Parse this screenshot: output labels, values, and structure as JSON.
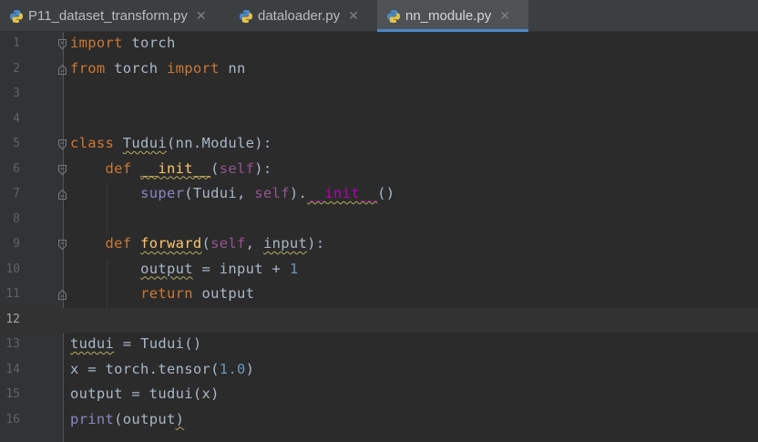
{
  "tabs": [
    {
      "label": "P11_dataset_transform.py",
      "active": false,
      "close": "✕"
    },
    {
      "label": "dataloader.py",
      "active": false,
      "close": "✕"
    },
    {
      "label": "nn_module.py",
      "active": true,
      "close": "✕"
    }
  ],
  "editor": {
    "current_line": 12,
    "lines": [
      {
        "n": "1",
        "tokens": [
          {
            "t": "import",
            "c": "kw"
          },
          {
            "t": " torch"
          }
        ]
      },
      {
        "n": "2",
        "tokens": [
          {
            "t": "from",
            "c": "kw"
          },
          {
            "t": " torch "
          },
          {
            "t": "import",
            "c": "kw"
          },
          {
            "t": " nn"
          }
        ]
      },
      {
        "n": "3",
        "tokens": []
      },
      {
        "n": "4",
        "tokens": []
      },
      {
        "n": "5",
        "tokens": [
          {
            "t": "class ",
            "c": "kw"
          },
          {
            "t": "Tudui",
            "c": "wavy"
          },
          {
            "t": "(nn.Module):"
          }
        ]
      },
      {
        "n": "6",
        "tokens": [
          {
            "t": "    "
          },
          {
            "t": "def ",
            "c": "kw"
          },
          {
            "t": "__init__",
            "c": "fn wavy"
          },
          {
            "t": "("
          },
          {
            "t": "self",
            "c": "self"
          },
          {
            "t": "):"
          }
        ]
      },
      {
        "n": "7",
        "tokens": [
          {
            "t": "        "
          },
          {
            "t": "super",
            "c": "bi"
          },
          {
            "t": "(Tudui, "
          },
          {
            "t": "self",
            "c": "self"
          },
          {
            "t": ")."
          },
          {
            "t": "__init__",
            "c": "magic wavy"
          },
          {
            "t": "()"
          }
        ]
      },
      {
        "n": "8",
        "tokens": []
      },
      {
        "n": "9",
        "tokens": [
          {
            "t": "    "
          },
          {
            "t": "def ",
            "c": "kw"
          },
          {
            "t": "forward",
            "c": "fn wavy"
          },
          {
            "t": "("
          },
          {
            "t": "self",
            "c": "self"
          },
          {
            "t": ", "
          },
          {
            "t": "input",
            "c": "wavy"
          },
          {
            "t": "):"
          }
        ]
      },
      {
        "n": "10",
        "tokens": [
          {
            "t": "        "
          },
          {
            "t": "output",
            "c": "wavy"
          },
          {
            "t": " = input + "
          },
          {
            "t": "1",
            "c": "num"
          }
        ]
      },
      {
        "n": "11",
        "tokens": [
          {
            "t": "        "
          },
          {
            "t": "return",
            "c": "kw"
          },
          {
            "t": " output"
          }
        ]
      },
      {
        "n": "12",
        "tokens": []
      },
      {
        "n": "13",
        "tokens": [
          {
            "t": "tudui",
            "c": "wavy"
          },
          {
            "t": " = Tudui()"
          }
        ]
      },
      {
        "n": "14",
        "tokens": [
          {
            "t": "x = torch.tensor("
          },
          {
            "t": "1.0",
            "c": "num"
          },
          {
            "t": ")"
          }
        ]
      },
      {
        "n": "15",
        "tokens": [
          {
            "t": "output = tudui(x)"
          }
        ]
      },
      {
        "n": "16",
        "tokens": [
          {
            "t": "print",
            "c": "bi"
          },
          {
            "t": "(output"
          },
          {
            "t": ")",
            "c": "wavy"
          }
        ]
      }
    ]
  },
  "colors": {
    "background": "#2b2b2b",
    "gutter": "#313335",
    "keyword": "#cc7832",
    "self": "#94558d",
    "function": "#ffc66d",
    "builtin": "#8888c6",
    "number": "#6897bb",
    "text": "#a9b7c6",
    "tab_accent": "#4a88c7"
  },
  "icons": {
    "tab_file": "python-file-icon",
    "fold": "fold-marker-icon",
    "close": "close-icon"
  }
}
